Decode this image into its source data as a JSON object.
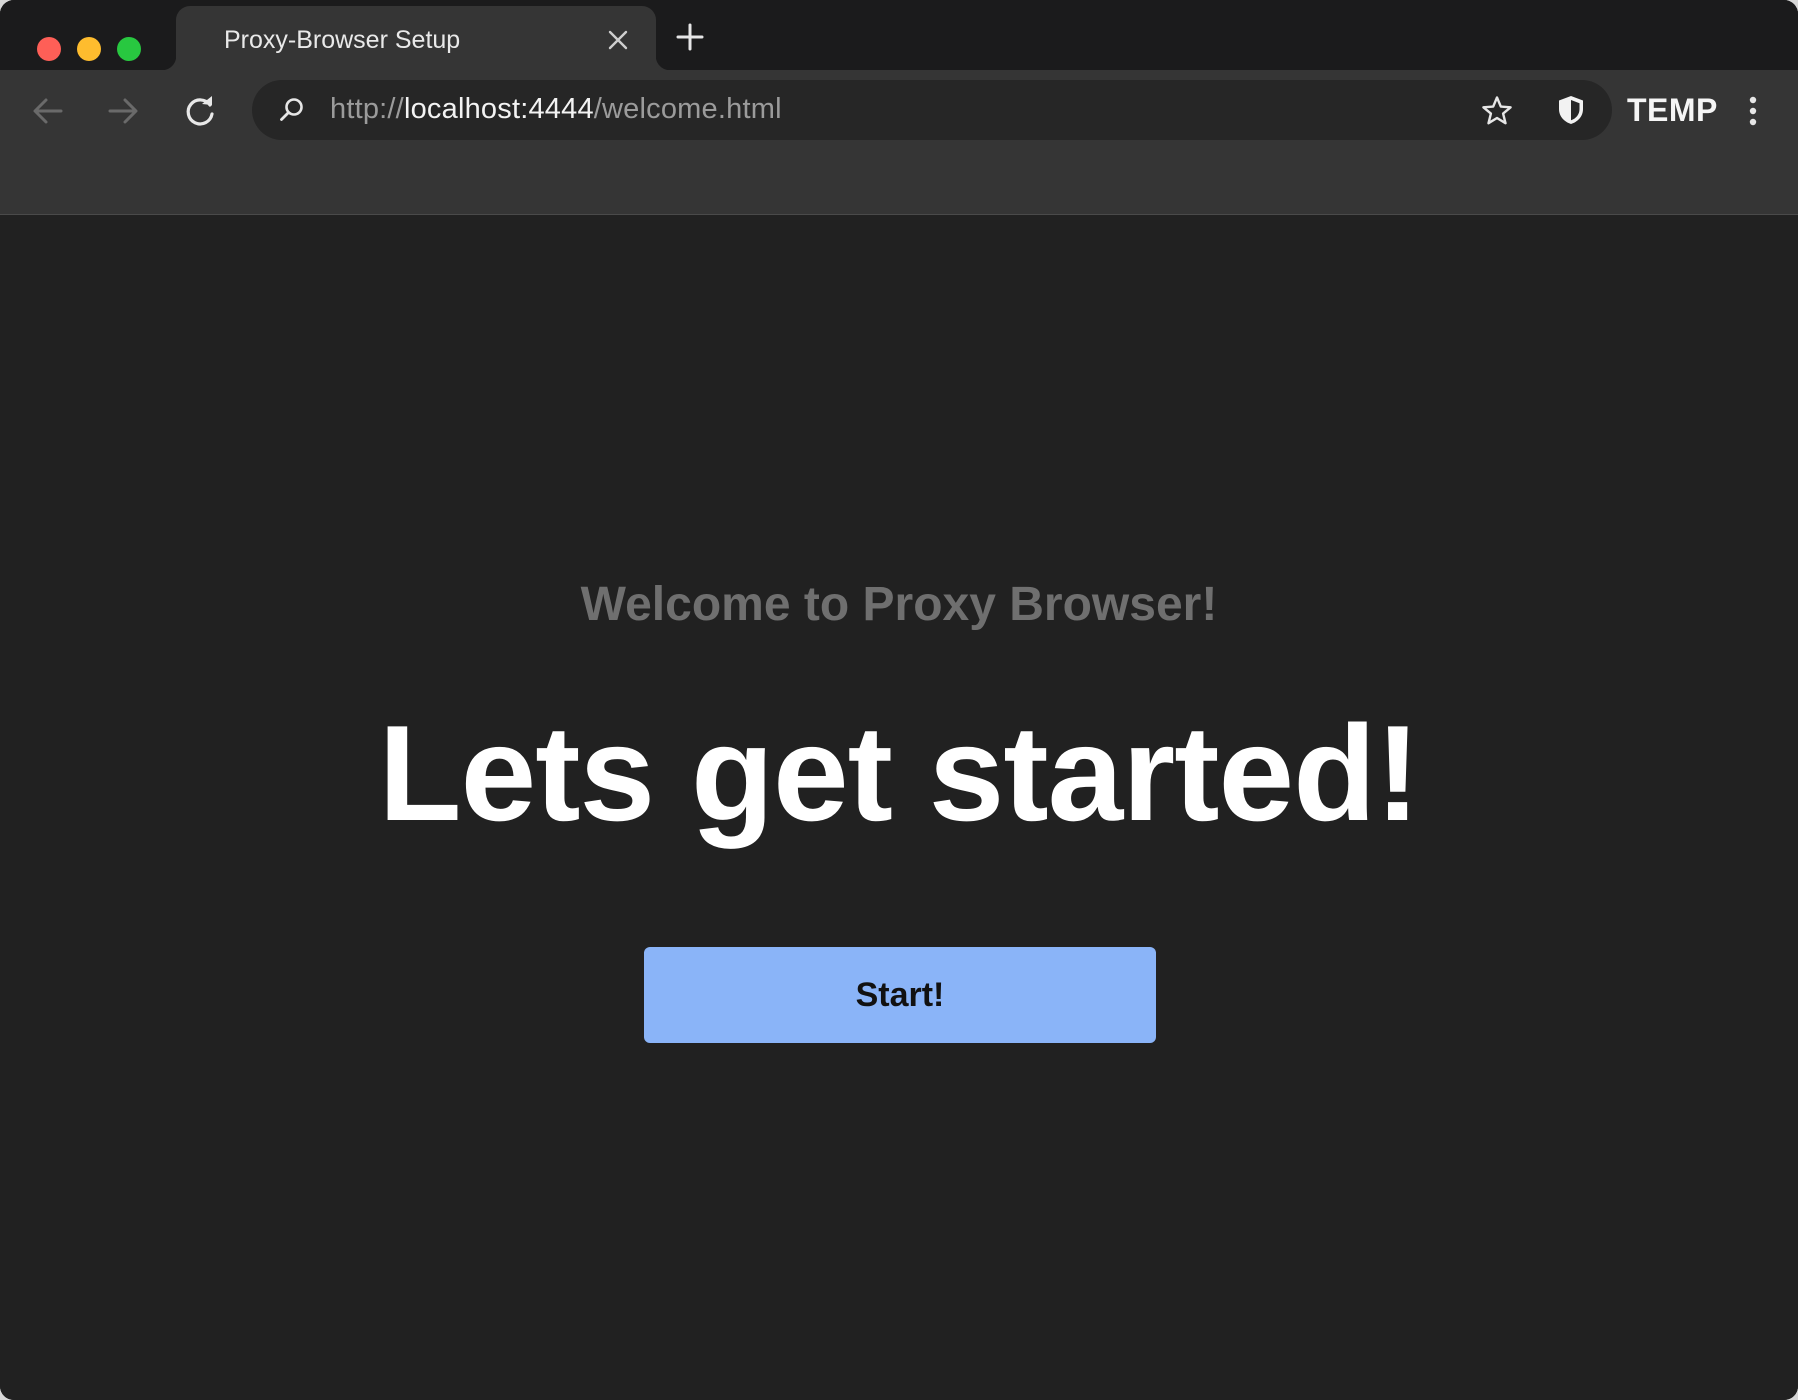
{
  "window": {
    "controls": [
      "close",
      "minimize",
      "zoom"
    ]
  },
  "tab": {
    "title": "Proxy-Browser Setup",
    "close_icon": "close-icon",
    "new_tab_icon": "plus-icon"
  },
  "toolbar": {
    "back_icon": "arrow-left-icon",
    "forward_icon": "arrow-right-icon",
    "reload_icon": "reload-icon",
    "url_scheme": "http://",
    "url_host": "localhost:4444",
    "url_path": "/welcome.html",
    "bookmark_icon": "star-icon",
    "shield_icon": "shield-icon",
    "profile_label": "TEMP",
    "menu_icon": "more-vertical-icon"
  },
  "page": {
    "subtitle": "Welcome to Proxy Browser!",
    "headline": "Lets get started!",
    "start_button_label": "Start!"
  },
  "colors": {
    "accent": "#8ab4f8",
    "background": "#212121",
    "toolbar": "#353535",
    "subtitle": "#6f6f6f"
  }
}
